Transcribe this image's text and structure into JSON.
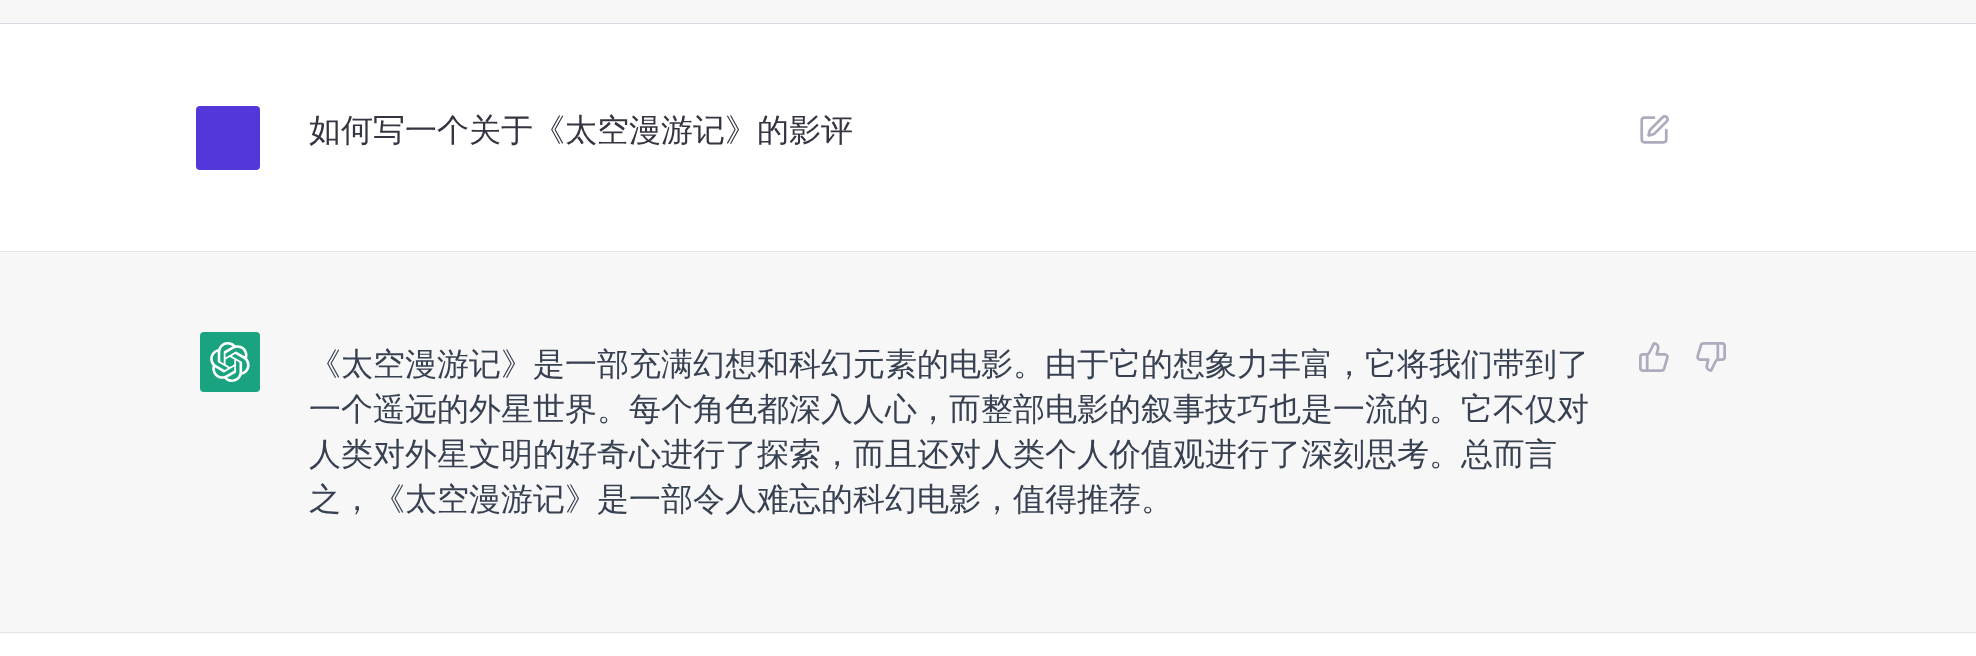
{
  "conversation": [
    {
      "kind": "user",
      "text": "如何写一个关于《太空漫游记》的影评"
    },
    {
      "kind": "assistant",
      "text": "《太空漫游记》是一部充满幻想和科幻元素的电影。由于它的想象力丰富，它将我们带到了一个遥远的外星世界。每个角色都深入人心，而整部电影的叙事技巧也是一流的。它不仅对人类对外星文明的好奇心进行了探索，而且还对人类个人价值观进行了深刻思考。总而言之，《太空漫游记》是一部令人难忘的科幻电影，值得推荐。"
    }
  ]
}
